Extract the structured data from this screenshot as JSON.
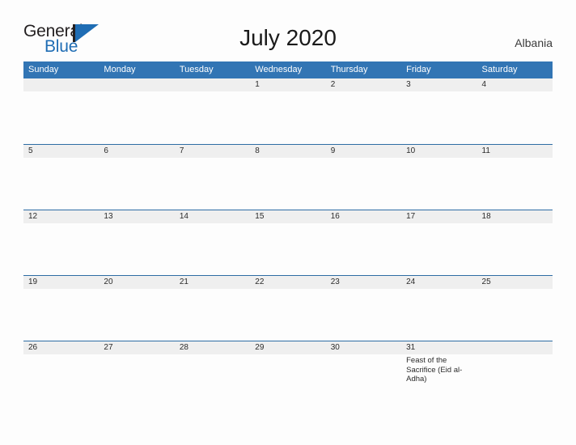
{
  "brand": {
    "name_top": "General",
    "name_bottom": "Blue",
    "flag_color": "#1f6db4"
  },
  "header": {
    "title": "July 2020",
    "country": "Albania"
  },
  "calendar": {
    "header_color": "#3275b4",
    "band_color": "#efefef",
    "weekdays": [
      "Sunday",
      "Monday",
      "Tuesday",
      "Wednesday",
      "Thursday",
      "Friday",
      "Saturday"
    ],
    "weeks": [
      [
        {
          "day": "",
          "events": []
        },
        {
          "day": "",
          "events": []
        },
        {
          "day": "",
          "events": []
        },
        {
          "day": "1",
          "events": []
        },
        {
          "day": "2",
          "events": []
        },
        {
          "day": "3",
          "events": []
        },
        {
          "day": "4",
          "events": []
        }
      ],
      [
        {
          "day": "5",
          "events": []
        },
        {
          "day": "6",
          "events": []
        },
        {
          "day": "7",
          "events": []
        },
        {
          "day": "8",
          "events": []
        },
        {
          "day": "9",
          "events": []
        },
        {
          "day": "10",
          "events": []
        },
        {
          "day": "11",
          "events": []
        }
      ],
      [
        {
          "day": "12",
          "events": []
        },
        {
          "day": "13",
          "events": []
        },
        {
          "day": "14",
          "events": []
        },
        {
          "day": "15",
          "events": []
        },
        {
          "day": "16",
          "events": []
        },
        {
          "day": "17",
          "events": []
        },
        {
          "day": "18",
          "events": []
        }
      ],
      [
        {
          "day": "19",
          "events": []
        },
        {
          "day": "20",
          "events": []
        },
        {
          "day": "21",
          "events": []
        },
        {
          "day": "22",
          "events": []
        },
        {
          "day": "23",
          "events": []
        },
        {
          "day": "24",
          "events": []
        },
        {
          "day": "25",
          "events": []
        }
      ],
      [
        {
          "day": "26",
          "events": []
        },
        {
          "day": "27",
          "events": []
        },
        {
          "day": "28",
          "events": []
        },
        {
          "day": "29",
          "events": []
        },
        {
          "day": "30",
          "events": []
        },
        {
          "day": "31",
          "events": [
            "Feast of the Sacrifice (Eid al-Adha)"
          ]
        },
        {
          "day": "",
          "events": []
        }
      ]
    ]
  }
}
